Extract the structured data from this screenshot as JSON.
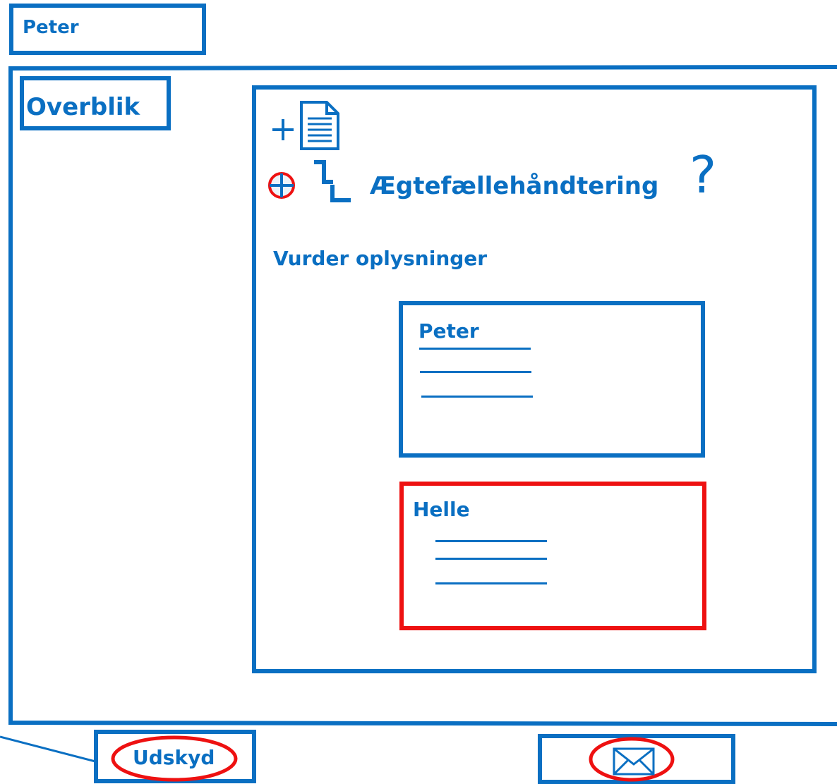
{
  "header": {
    "user_name": "Peter"
  },
  "nav": {
    "overview_label": "Overblik"
  },
  "panel": {
    "title": "Ægtefællehåndtering",
    "help_symbol": "?",
    "section_label": "Vurder oplysninger",
    "persons": [
      {
        "name": "Peter",
        "highlighted": false
      },
      {
        "name": "Helle",
        "highlighted": true
      }
    ]
  },
  "footer": {
    "postpone_label": "Udskyd"
  },
  "icons": {
    "new_document": "new-document-icon",
    "add": "add-circle-icon",
    "step": "step-icon",
    "help": "help-icon",
    "mail": "envelope-icon"
  },
  "colors": {
    "primary": "#0a6fc2",
    "highlight": "#ee1111",
    "background": "#ffffff"
  }
}
